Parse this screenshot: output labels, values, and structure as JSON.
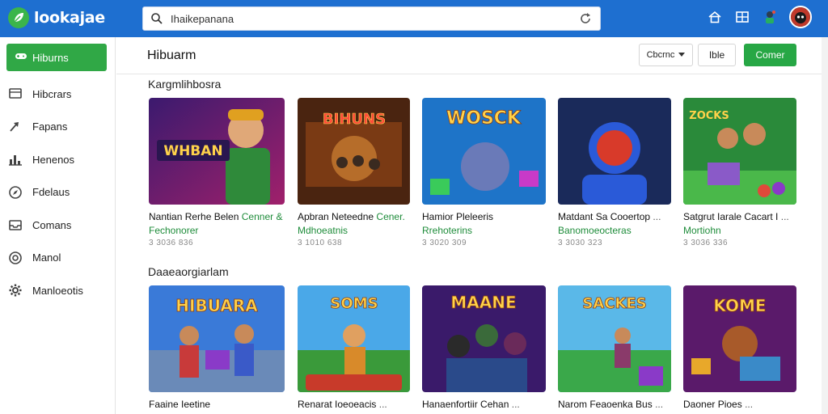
{
  "app": {
    "name": "lookajae",
    "brand_color": "#1e6fd0",
    "accent_green": "#30a846"
  },
  "search": {
    "value": "Ihaikepanana",
    "placeholder": ""
  },
  "sidebar": {
    "primary_label": "Hiburns",
    "items": [
      {
        "label": "Hibcrars",
        "icon": "monitor-icon"
      },
      {
        "label": "Fapans",
        "icon": "trending-arrow-icon"
      },
      {
        "label": "Henenos",
        "icon": "bar-chart-icon"
      },
      {
        "label": "Fdelaus",
        "icon": "compass-icon"
      },
      {
        "label": "Comans",
        "icon": "inbox-icon"
      },
      {
        "label": "Manol",
        "icon": "target-icon"
      },
      {
        "label": "Manloeotis",
        "icon": "gear-icon"
      }
    ]
  },
  "header": {
    "title": "Hibuarm",
    "select_label": "Cbcrnc",
    "plain_button": "Ible",
    "green_button": "Comer"
  },
  "sections": [
    {
      "title": "Kargmlihbosra",
      "cards": [
        {
          "title": "Nantian Rerhe Belen",
          "title_extra": "Cenner &",
          "subtitle": "Fechonorer",
          "meta": "3 3036 836",
          "art": "WHBAN"
        },
        {
          "title": "Apbran Neteedne",
          "title_extra": "Cener.",
          "subtitle": "Mdhoeatnis",
          "meta": "3 1010 638",
          "art": "BIHUNS"
        },
        {
          "title": "Hamior Pleleeris",
          "title_extra": "",
          "subtitle": "Rrehoterins",
          "meta": "3 3020 309",
          "art": "WOSCK"
        },
        {
          "title": "Matdant Sa Cooertop",
          "title_extra": "...",
          "subtitle": "Banomoeocteras",
          "meta": "3 3030 323",
          "art": ""
        },
        {
          "title": "Satgrut Iarale Cacart I",
          "title_extra": "...",
          "subtitle": "Mortiohn",
          "meta": "3 3036 336",
          "art": "ZOCKS"
        }
      ]
    },
    {
      "title": "Daaeaorgiarlam",
      "cards": [
        {
          "title": "Faaine Ieetine",
          "title_extra": "",
          "subtitle": "",
          "meta": "",
          "art": "HIBUARA"
        },
        {
          "title": "Renarat Ioeoeacis",
          "title_extra": "...",
          "subtitle": "",
          "meta": "",
          "art": "SOMS"
        },
        {
          "title": "Hanaenfortiir Cehan",
          "title_extra": "...",
          "subtitle": "",
          "meta": "",
          "art": "MAANE"
        },
        {
          "title": "Narom Feaoenka Bus",
          "title_extra": "...",
          "subtitle": "",
          "meta": "",
          "art": "SACKES"
        },
        {
          "title": "Daoner Pioes",
          "title_extra": "...",
          "subtitle": "",
          "meta": "",
          "art": "KOME"
        }
      ]
    }
  ]
}
